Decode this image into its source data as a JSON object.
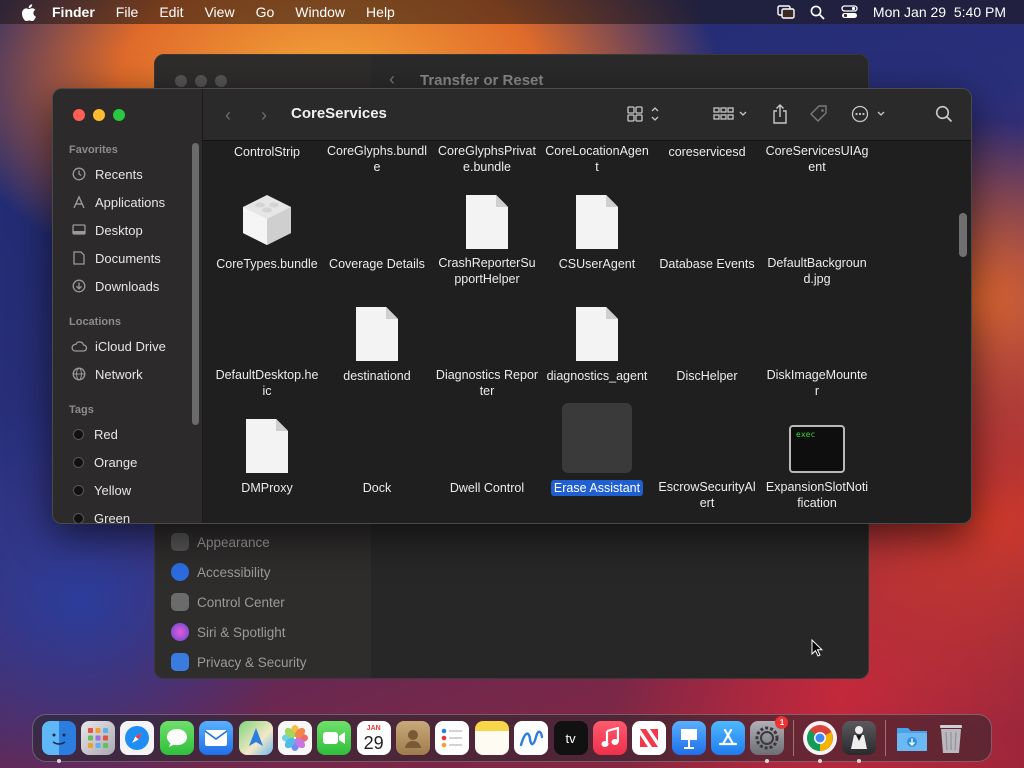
{
  "menubar": {
    "app_name": "Finder",
    "items": [
      "File",
      "Edit",
      "View",
      "Go",
      "Window",
      "Help"
    ],
    "datetime": "Mon Jan 29  5:40 PM"
  },
  "settings_window": {
    "title": "Transfer or Reset",
    "rows": [
      {
        "label": "Appearance",
        "color": "#555555"
      },
      {
        "label": "Accessibility",
        "color": "#2d6cdf"
      },
      {
        "label": "Control Center",
        "color": "#6b6b6b"
      },
      {
        "label": "Siri & Spotlight",
        "color": "#b04ad8"
      },
      {
        "label": "Privacy & Security",
        "color": "#3a7be0"
      }
    ]
  },
  "finder": {
    "title": "CoreServices",
    "sidebar": {
      "favorites_label": "Favorites",
      "favorites": [
        {
          "label": "Recents",
          "icon": "clock-icon"
        },
        {
          "label": "Applications",
          "icon": "applications-icon"
        },
        {
          "label": "Desktop",
          "icon": "desktop-icon"
        },
        {
          "label": "Documents",
          "icon": "document-icon"
        },
        {
          "label": "Downloads",
          "icon": "download-icon"
        }
      ],
      "locations_label": "Locations",
      "locations": [
        {
          "label": "iCloud Drive",
          "icon": "cloud-icon"
        },
        {
          "label": "Network",
          "icon": "globe-icon"
        }
      ],
      "tags_label": "Tags",
      "tags": [
        "Red",
        "Orange",
        "Yellow",
        "Green"
      ]
    },
    "items": [
      {
        "label": "ControlStrip",
        "icon": "none"
      },
      {
        "label": "CoreGlyphs.bundle",
        "icon": "none"
      },
      {
        "label": "CoreGlyphsPrivate.bundle",
        "icon": "none"
      },
      {
        "label": "CoreLocationAgent",
        "icon": "none"
      },
      {
        "label": "coreservicesd",
        "icon": "none"
      },
      {
        "label": "CoreServicesUIAgent",
        "icon": "none"
      },
      {
        "label": "CoreTypes.bundle",
        "icon": "lego"
      },
      {
        "label": "Coverage Details",
        "icon": "none"
      },
      {
        "label": "CrashReporterSupportHelper",
        "icon": "doc"
      },
      {
        "label": "CSUserAgent",
        "icon": "doc"
      },
      {
        "label": "Database Events",
        "icon": "none"
      },
      {
        "label": "DefaultBackground.jpg",
        "icon": "none"
      },
      {
        "label": "DefaultDesktop.heic",
        "icon": "none"
      },
      {
        "label": "destinationd",
        "icon": "doc"
      },
      {
        "label": "Diagnostics Reporter",
        "icon": "none"
      },
      {
        "label": "diagnostics_agent",
        "icon": "doc"
      },
      {
        "label": "DiscHelper",
        "icon": "none"
      },
      {
        "label": "DiskImageMounter",
        "icon": "none"
      },
      {
        "label": "DMProxy",
        "icon": "doc"
      },
      {
        "label": "Dock",
        "icon": "none"
      },
      {
        "label": "Dwell Control",
        "icon": "none"
      },
      {
        "label": "Erase Assistant",
        "icon": "selected"
      },
      {
        "label": "EscrowSecurityAlert",
        "icon": "none"
      },
      {
        "label": "ExpansionSlotNotification",
        "icon": "exec"
      }
    ],
    "exec_text": "exec"
  },
  "dock": {
    "calendar_month": "JAN",
    "calendar_day": "29",
    "tv_label": "tv",
    "settings_badge": "1"
  }
}
